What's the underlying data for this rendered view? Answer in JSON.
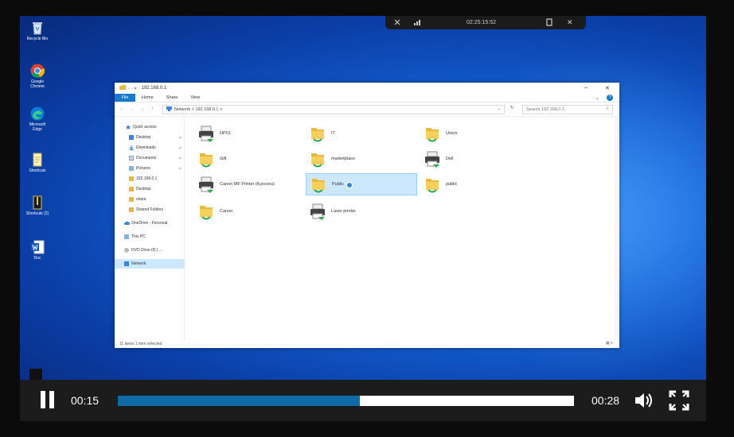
{
  "session_bar": {
    "time": "02:25:15:52",
    "close_label": "✕"
  },
  "desktop_icons": [
    {
      "label": "Recycle Bin"
    },
    {
      "label": "Google Chrome"
    },
    {
      "label": "Microsoft Edge"
    },
    {
      "label": "Shortcuts"
    },
    {
      "label": "Shortcuts (2)"
    },
    {
      "label": "Doc"
    }
  ],
  "explorer": {
    "title": "192.168.0.1",
    "ribbon_tabs": {
      "file": "File",
      "home": "Home",
      "share": "Share",
      "view": "View"
    },
    "address": "Network > 192.168.0.1 >",
    "search_placeholder": "Search 192.168.0.1",
    "nav": [
      {
        "label": "Quick access"
      },
      {
        "label": "Desktop"
      },
      {
        "label": "Downloads"
      },
      {
        "label": "Documents"
      },
      {
        "label": "Pictures"
      },
      {
        "label": "192.168.0.1"
      },
      {
        "label": "Desktop"
      },
      {
        "label": "share"
      },
      {
        "label": "Shared Folders"
      },
      {
        "label": "OneDrive - Personal"
      },
      {
        "label": "This PC"
      },
      {
        "label": "DVD Drive (D:) ..."
      },
      {
        "label": "Network"
      }
    ],
    "items": [
      {
        "label": "HP01",
        "type": "printer"
      },
      {
        "label": "IT",
        "type": "folder"
      },
      {
        "label": "Users",
        "type": "folder"
      },
      {
        "label": "Gift",
        "type": "folder"
      },
      {
        "label": "marketplace",
        "type": "folder"
      },
      {
        "label": "Dell",
        "type": "printer"
      },
      {
        "label": "Canon MF Printer (Kyocera)",
        "type": "printer"
      },
      {
        "label": "Public",
        "type": "folder"
      },
      {
        "label": "public",
        "type": "folder"
      },
      {
        "label": "Canon",
        "type": "folder"
      },
      {
        "label": "Laser printer",
        "type": "printer"
      }
    ],
    "status": "11 items    1 item selected"
  },
  "player": {
    "elapsed": "00:15",
    "duration": "00:28",
    "progress_fraction": 0.53
  },
  "colors": {
    "accent": "#0f6aa6",
    "selection": "#cce8ff",
    "file_tab": "#1979ca"
  }
}
